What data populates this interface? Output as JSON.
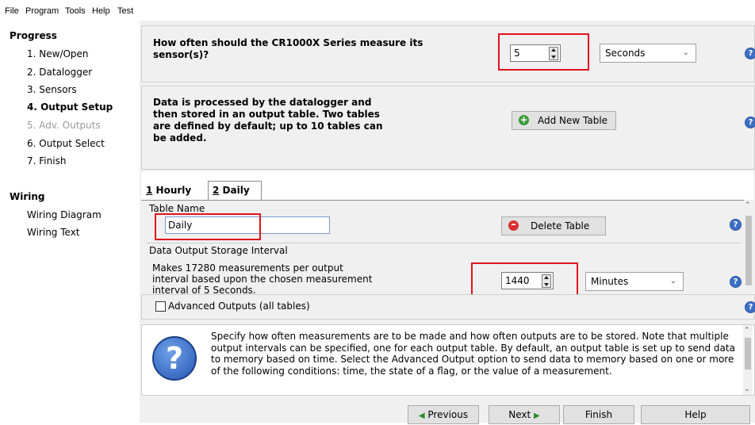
{
  "menu": {
    "file": "File",
    "program": "Program",
    "tools": "Tools",
    "help": "Help",
    "test": "Test"
  },
  "sidebar": {
    "progress_heading": "Progress",
    "progress_items": [
      {
        "label": "1. New/Open",
        "state": "normal"
      },
      {
        "label": "2. Datalogger",
        "state": "normal"
      },
      {
        "label": "3. Sensors",
        "state": "normal"
      },
      {
        "label": "4. Output Setup",
        "state": "active"
      },
      {
        "label": "5. Adv. Outputs",
        "state": "disabled"
      },
      {
        "label": "6. Output Select",
        "state": "normal"
      },
      {
        "label": "7. Finish",
        "state": "normal"
      }
    ],
    "wiring_heading": "Wiring",
    "wiring_items": [
      "Wiring Diagram",
      "Wiring Text"
    ]
  },
  "measure": {
    "question": "How often should the CR1000X Series measure its sensor(s)?",
    "interval_value": "5",
    "unit": "Seconds"
  },
  "tables_info": {
    "text": "Data is processed by the datalogger and then stored in an output table. Two tables are defined by default; up to 10 tables can be added.",
    "add_button": "Add New Table"
  },
  "tabs": [
    {
      "num": "1",
      "label": "Hourly"
    },
    {
      "num": "2",
      "label": "Daily"
    }
  ],
  "table_editor": {
    "name_label": "Table Name",
    "name_value": "Daily",
    "delete_button": "Delete Table",
    "storage_label": "Data Output Storage Interval",
    "storage_text": "Makes 17280 measurements per output interval based upon the chosen measurement interval of 5 Seconds.",
    "interval_value": "1440",
    "interval_unit": "Minutes"
  },
  "advanced": {
    "label": "Advanced Outputs (all tables)"
  },
  "help_text": "Specify how often measurements are to be made and how often outputs are to be stored. Note that multiple output intervals can be specified, one for each output table. By default, an output table is set up to send data to memory based on time. Select the Advanced Output option to send data to memory based on one or more of the following conditions: time, the state of a flag, or the value of a measurement.",
  "footer": {
    "previous": "Previous",
    "next": "Next",
    "finish": "Finish",
    "help": "Help"
  },
  "colors": {
    "highlight_box": "#e0141c",
    "help_icon": "#3d6fc4",
    "add_icon": "#3a9a3a",
    "delete_icon": "#d93030"
  }
}
